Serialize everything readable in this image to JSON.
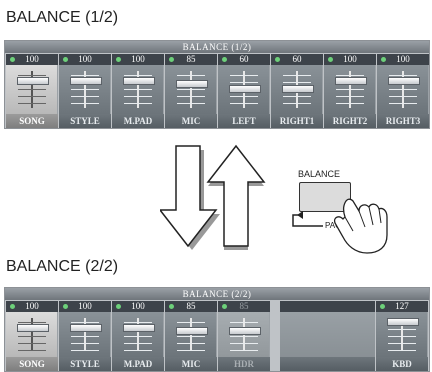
{
  "page1": {
    "heading": "BALANCE (1/2)",
    "title": "BALANCE (1/2)",
    "channels": [
      {
        "name": "SONG",
        "value": "100",
        "selected": true,
        "level": 100
      },
      {
        "name": "STYLE",
        "value": "100",
        "selected": false,
        "level": 100
      },
      {
        "name": "M.PAD",
        "value": "100",
        "selected": false,
        "level": 100
      },
      {
        "name": "MIC",
        "value": "85",
        "selected": false,
        "level": 85
      },
      {
        "name": "LEFT",
        "value": "60",
        "selected": false,
        "level": 60
      },
      {
        "name": "RIGHT1",
        "value": "60",
        "selected": false,
        "level": 60
      },
      {
        "name": "RIGHT2",
        "value": "100",
        "selected": false,
        "level": 100
      },
      {
        "name": "RIGHT3",
        "value": "100",
        "selected": false,
        "level": 100
      }
    ]
  },
  "page2": {
    "heading": "BALANCE (2/2)",
    "title": "BALANCE (2/2)",
    "channels": [
      {
        "name": "SONG",
        "value": "100",
        "selected": true,
        "level": 100,
        "disabled": false
      },
      {
        "name": "STYLE",
        "value": "100",
        "selected": false,
        "level": 100,
        "disabled": false
      },
      {
        "name": "M.PAD",
        "value": "100",
        "selected": false,
        "level": 100,
        "disabled": false
      },
      {
        "name": "MIC",
        "value": "85",
        "selected": false,
        "level": 85,
        "disabled": false
      },
      {
        "name": "HDR",
        "value": "85",
        "selected": false,
        "level": 85,
        "disabled": true
      }
    ],
    "kbd": {
      "name": "KBD",
      "value": "127",
      "level": 127
    }
  },
  "button": {
    "label": "BALANCE",
    "page_label": "PAGE"
  },
  "colors": {
    "panel_bg": "#bfc3c7",
    "title_bar": "#6f757b",
    "value_strip": "#3d434a",
    "selected_channel": "#dcdcdc",
    "indicator": "#6dd07a"
  }
}
